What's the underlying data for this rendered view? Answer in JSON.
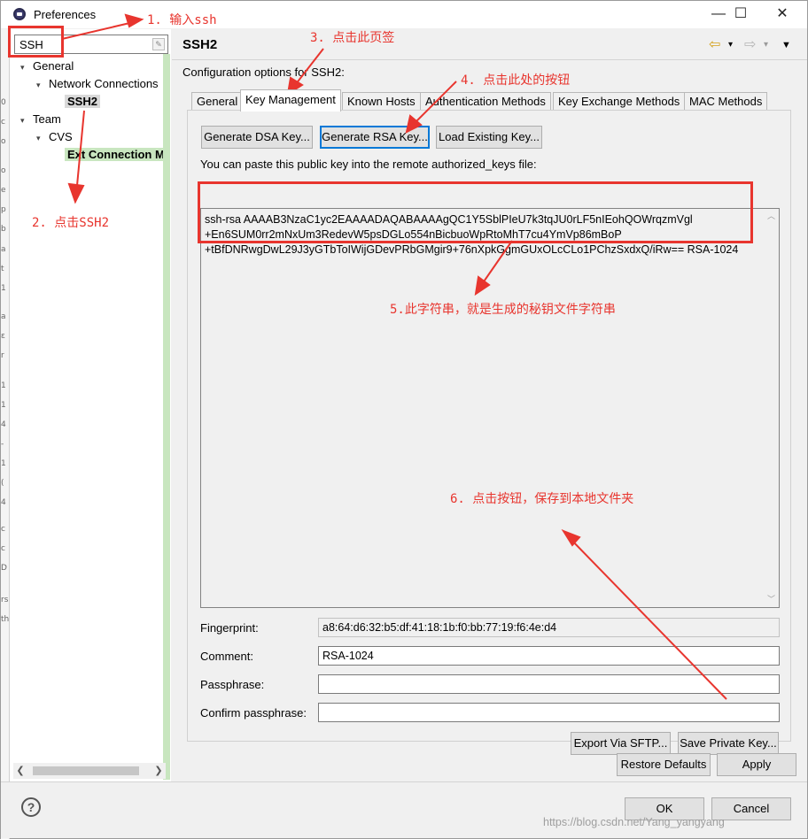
{
  "window": {
    "title": "Preferences",
    "minimize": "—",
    "maximize": "☐",
    "close": "✕"
  },
  "background_fragments": [
    "0",
    "c",
    "o",
    "o",
    "e",
    "p",
    "b",
    "a",
    "t",
    "1",
    "a",
    "ε",
    "r",
    "1",
    "1",
    "4",
    "-",
    "1",
    "(",
    "4",
    "c",
    "c",
    "D",
    "rs",
    "th"
  ],
  "search": {
    "value": "SSH"
  },
  "tree": [
    {
      "label": "General",
      "level": 1,
      "expanded": true
    },
    {
      "label": "Network Connections",
      "level": 2,
      "expanded": true
    },
    {
      "label": "SSH2",
      "level": 3,
      "selected": true
    },
    {
      "label": "Team",
      "level": 1,
      "expanded": true
    },
    {
      "label": "CVS",
      "level": 2,
      "expanded": true
    },
    {
      "label": "Ext Connection Method",
      "level": 3,
      "highlight": true
    }
  ],
  "page": {
    "title": "SSH2",
    "description": "Configuration options for SSH2:",
    "back_icon": "⇦",
    "forward_icon": "⇨",
    "dropdown_icon": "▾",
    "menu_icon": "▼"
  },
  "tabs": [
    "General",
    "Key Management",
    "Known Hosts",
    "Authentication Methods",
    "Key Exchange Methods",
    "MAC Methods"
  ],
  "active_tab": 1,
  "key_management": {
    "buttons": {
      "generate_dsa": "Generate DSA Key...",
      "generate_rsa": "Generate RSA Key...",
      "load_existing": "Load Existing Key..."
    },
    "paste_label": "You can paste this public key into the remote authorized_keys file:",
    "public_key_lines": [
      "ssh-rsa AAAAB3NzaC1yc2EAAAADAQABAAAAgQC1Y5SblPIeU7k3tqJU0rLF5nIEohQOWrqzmVgl",
      "+En6SUM0rr2mNxUm3RedevW5psDGLo554nBicbuoWpRtoMhT7cu4YmVp86mBoP",
      "+tBfDNRwgDwL29J3yGTbToIWijGDevPRbGMgir9+76nXpkGgmGUxOLcCLo1PChzSxdxQ/iRw== RSA-1024"
    ],
    "fingerprint_label": "Fingerprint:",
    "fingerprint_value": "a8:64:d6:32:b5:df:41:18:1b:f0:bb:77:19:f6:4e:d4",
    "comment_label": "Comment:",
    "comment_value": "RSA-1024",
    "passphrase_label": "Passphrase:",
    "passphrase_value": "",
    "confirm_label": "Confirm passphrase:",
    "confirm_value": "",
    "export_button": "Export Via SFTP...",
    "save_private_button": "Save Private Key..."
  },
  "page_buttons": {
    "restore_defaults": "Restore Defaults",
    "apply": "Apply"
  },
  "dialog_buttons": {
    "help_icon": "?",
    "ok": "OK",
    "cancel": "Cancel"
  },
  "watermark": "https://blog.csdn.net/Yang_yangyang",
  "annotations": {
    "step1": "1. 输入ssh",
    "step2": "2. 点击SSH2",
    "step3": "3. 点击此页签",
    "step4": "4. 点击此处的按钮",
    "step5": "5.此字符串，就是生成的秘钥文件字符串",
    "step6": "6. 点击按钮，保存到本地文件夹",
    "color": "#e8352e"
  }
}
